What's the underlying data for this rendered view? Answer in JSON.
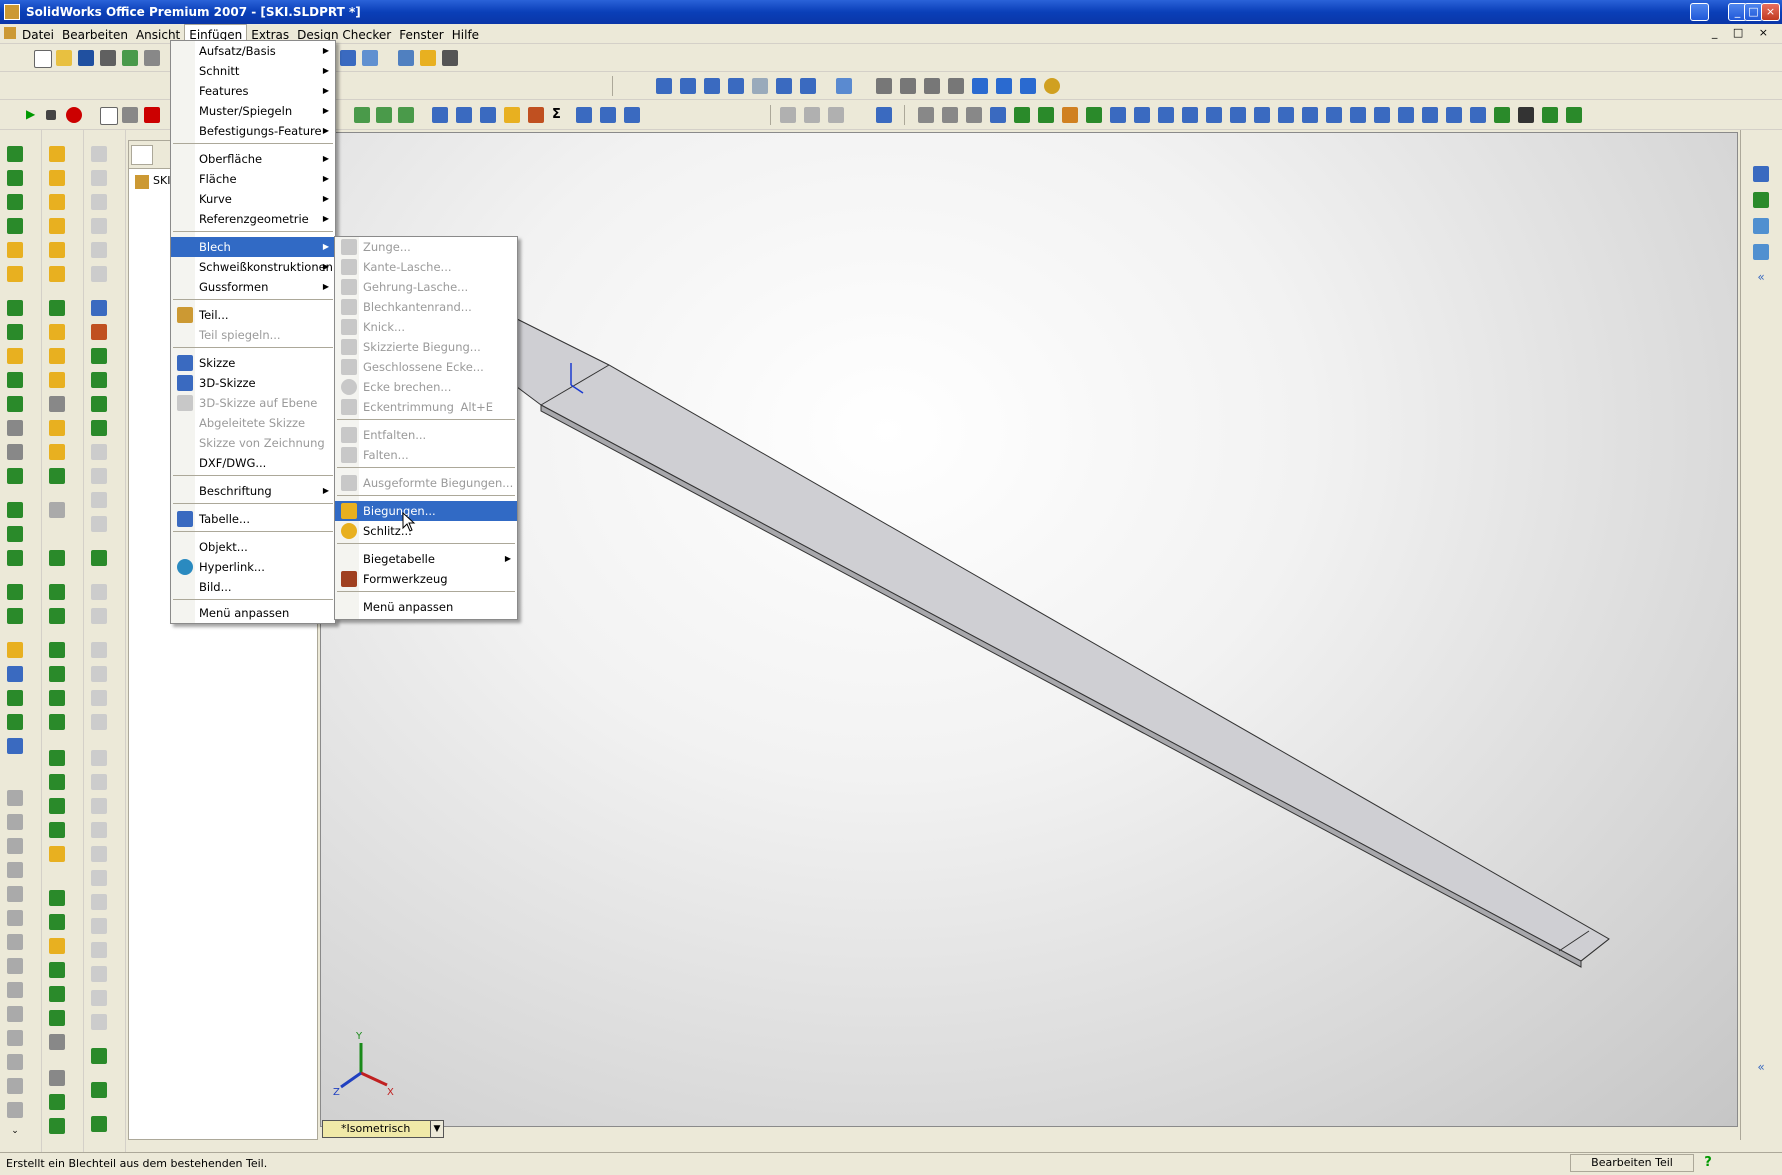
{
  "window": {
    "title": "SolidWorks Office Premium 2007 - [SKI.SLDPRT *]",
    "buttons": {
      "minimize": "_",
      "maximize": "□",
      "close": "×"
    }
  },
  "menubar": {
    "items": [
      "Datei",
      "Bearbeiten",
      "Ansicht",
      "Einfügen",
      "Extras",
      "Design Checker",
      "Fenster",
      "Hilfe"
    ],
    "doc_controls": "_ □ ×"
  },
  "insert_menu": {
    "items": [
      {
        "label": "Aufsatz/Basis",
        "submenu": true
      },
      {
        "label": "Schnitt",
        "submenu": true
      },
      {
        "label": "Features",
        "submenu": true
      },
      {
        "label": "Muster/Spiegeln",
        "submenu": true
      },
      {
        "label": "Befestigungs-Feature",
        "submenu": true
      },
      {
        "label": "Oberfläche",
        "submenu": true
      },
      {
        "label": "Fläche",
        "submenu": true
      },
      {
        "label": "Kurve",
        "submenu": true
      },
      {
        "label": "Referenzgeometrie",
        "submenu": true
      },
      {
        "label": "Blech",
        "submenu": true,
        "highlighted": true
      },
      {
        "label": "Schweißkonstruktionen",
        "submenu": true
      },
      {
        "label": "Gussformen",
        "submenu": true
      },
      {
        "label": "Teil..."
      },
      {
        "label": "Teil spiegeln...",
        "disabled": true
      },
      {
        "label": "Skizze"
      },
      {
        "label": "3D-Skizze"
      },
      {
        "label": "3D-Skizze auf Ebene",
        "disabled": true
      },
      {
        "label": "Abgeleitete Skizze",
        "disabled": true
      },
      {
        "label": "Skizze von Zeichnung",
        "disabled": true
      },
      {
        "label": "DXF/DWG..."
      },
      {
        "label": "Beschriftung",
        "submenu": true
      },
      {
        "label": "Tabelle..."
      },
      {
        "label": "Objekt..."
      },
      {
        "label": "Hyperlink..."
      },
      {
        "label": "Bild..."
      },
      {
        "label": "Menü anpassen"
      }
    ]
  },
  "sheetmetal_menu": {
    "items": [
      {
        "label": "Zunge...",
        "disabled": true
      },
      {
        "label": "Kante-Lasche...",
        "disabled": true
      },
      {
        "label": "Gehrung-Lasche...",
        "disabled": true
      },
      {
        "label": "Blechkantenrand...",
        "disabled": true
      },
      {
        "label": "Knick...",
        "disabled": true
      },
      {
        "label": "Skizzierte Biegung...",
        "disabled": true
      },
      {
        "label": "Geschlossene Ecke...",
        "disabled": true
      },
      {
        "label": "Ecke brechen...",
        "disabled": true
      },
      {
        "label": "Eckentrimmung",
        "disabled": true,
        "shortcut": "Alt+E"
      },
      {
        "label": "Entfalten...",
        "disabled": true
      },
      {
        "label": "Falten...",
        "disabled": true
      },
      {
        "label": "Ausgeformte Biegungen...",
        "disabled": true
      },
      {
        "label": "Biegungen...",
        "highlighted": true
      },
      {
        "label": "Schlitz..."
      },
      {
        "label": "Biegetabelle",
        "submenu": true
      },
      {
        "label": "Formwerkzeug"
      },
      {
        "label": "Menü anpassen"
      }
    ]
  },
  "feature_tree": {
    "root": "SKI"
  },
  "viewport": {
    "view_orientation": "*Isometrisch",
    "axes": {
      "x": "X",
      "y": "Y",
      "z": "Z"
    }
  },
  "statusbar": {
    "message": "Erstellt ein Blechteil aus dem bestehenden Teil.",
    "mode": "Bearbeiten Teil",
    "help": "?"
  },
  "colors": {
    "highlight": "#316ac5",
    "titlebar": "#0a3fb8",
    "chrome": "#ece9d8"
  }
}
